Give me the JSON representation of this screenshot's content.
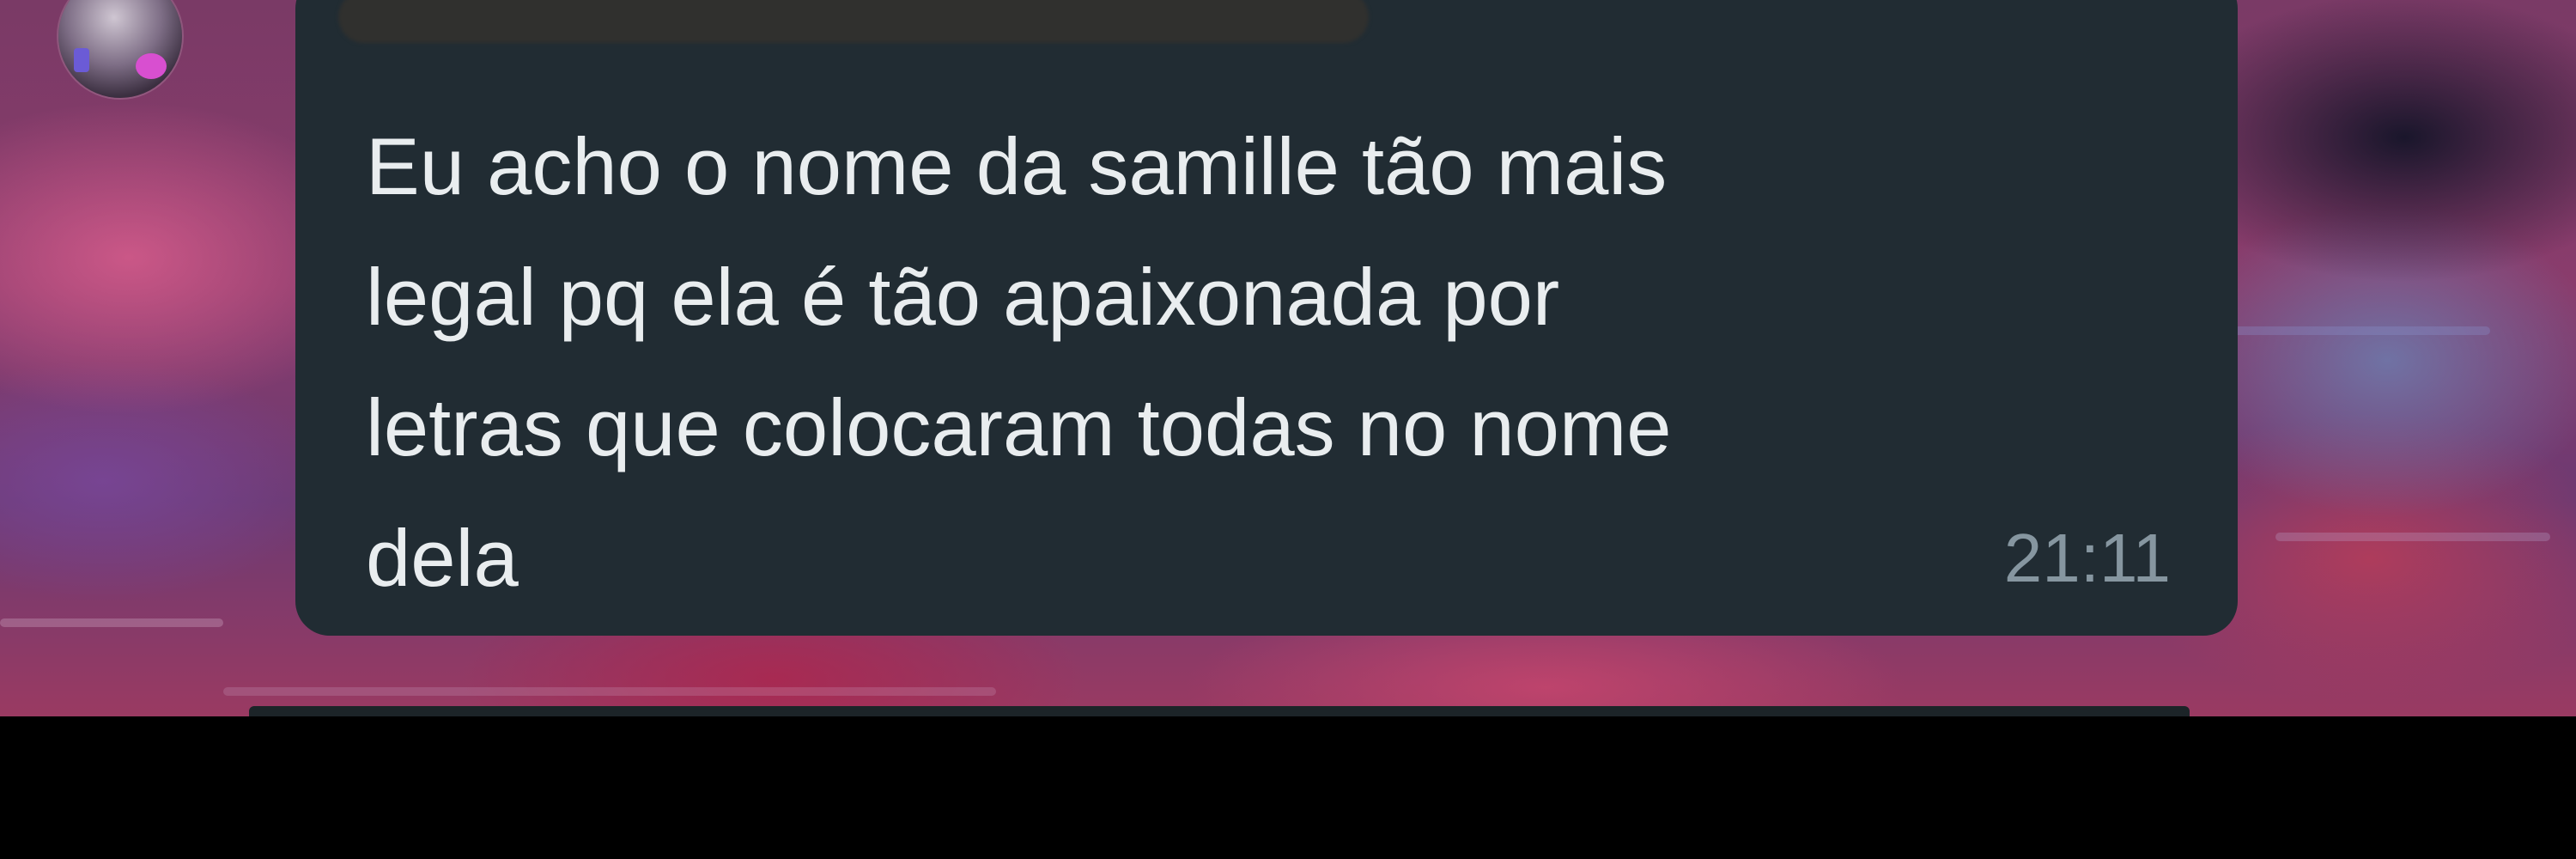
{
  "message": {
    "text": "Eu acho o nome da samille tão mais\nlegal pq ela é tão apaixonada por\nletras que colocaram todas no nome\ndela",
    "time": "21:11"
  },
  "colors": {
    "bubble_background": "#212c33",
    "message_text": "#e9edef",
    "timestamp": "#8696a0",
    "bottom_bar": "#000000"
  },
  "icons": {
    "avatar": "contact-avatar"
  }
}
